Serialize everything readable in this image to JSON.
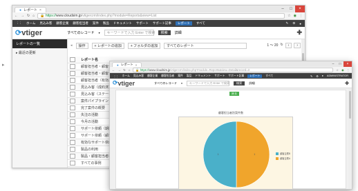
{
  "windows": [
    {
      "tab_title": "レポート",
      "url": {
        "scheme": "https",
        "host": "www.cloudsim.jp",
        "path": "/vtigercrm/index.php?module=Reports&view=List"
      },
      "nav": {
        "items": [
          "ホーム",
          "見込み客",
          "顧客企業",
          "顧客担当者",
          "案件",
          "製品",
          "ドキュメント",
          "サポート",
          "サポート記事",
          "レポート",
          "すべて"
        ],
        "active": "レポート"
      },
      "header": {
        "logo_text": "vtiger",
        "scope_select": "すべてのレコード",
        "search_placeholder": "キーワードで入力 Enter で検索",
        "search_button": "検索",
        "advanced": "詳細"
      },
      "sidebar": {
        "title": "レポートの一覧",
        "items": [
          "最近の更新"
        ]
      },
      "toolbar": {
        "back": "操作",
        "add_report": "+ レポートの追加",
        "add_folder": "+ フォルダの追加",
        "folder_select": "すべてのレポート",
        "range": "1 〜 20"
      },
      "list": {
        "header": "レポート名",
        "rows": [
          "顧客担当者・顧客企業毎",
          "顧客担当者・顧客企業毎",
          "顧客担当者（有効）",
          "見込み客（成約済）",
          "見込み客（ステータス別）",
          "案件パイプライン",
          "完了案件の概要",
          "失注の活動",
          "今月の活動",
          "サポート依頼（期限切れ）",
          "サポート依頼（顧客企業別）",
          "有効なサポート依頼",
          "製品の利用",
          "製品・顧客担当者毎",
          "すべての事例"
        ]
      }
    },
    {
      "tab_title": "レポート",
      "url": {
        "scheme": "https",
        "host": "www.cloudsim.jp",
        "path": "/vtigercrm/index.php?module=Reports&view=Detail&record=3"
      },
      "nav": {
        "items": [
          "ホーム",
          "見込み客",
          "顧客企業",
          "顧客担当者",
          "案件",
          "製品",
          "ドキュメント",
          "サポート",
          "サポート記事",
          "レポート",
          "すべて"
        ],
        "active": "レポート"
      },
      "header": {
        "logo_text": "vtiger",
        "scope_select": "すべてのレコード",
        "search_placeholder": "キーワードで入力 Enter で検索",
        "search_button": "検索",
        "advanced": "詳細",
        "user": "ADMINISTRATOR"
      },
      "action_button": "戻る"
    }
  ],
  "chart_data": {
    "type": "pie",
    "title": "顧客担当者別案件数",
    "labels": [
      "顧客企業A",
      "顧客企業B"
    ],
    "values": [
      1,
      1
    ],
    "colors": [
      "#f0a52c",
      "#4ab0c9"
    ],
    "slice_labels": [
      "1",
      "1"
    ],
    "legend_position": "right"
  }
}
